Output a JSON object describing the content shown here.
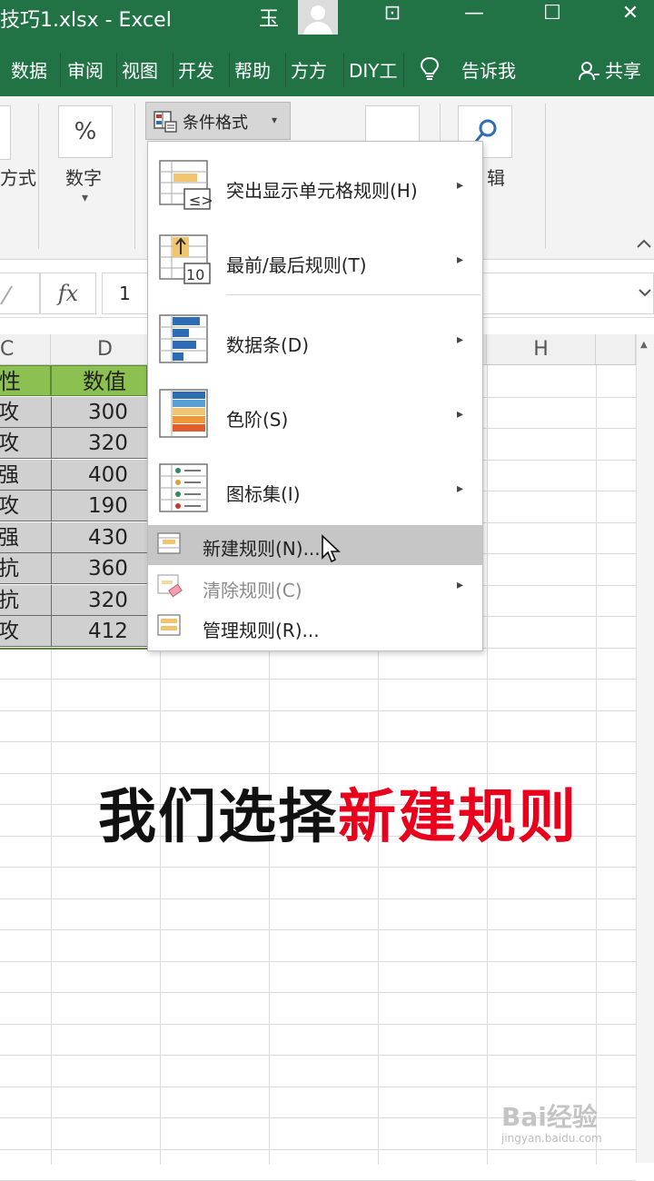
{
  "window": {
    "title": "技巧1.xlsx  -  Excel",
    "user_name": "玉",
    "minimize_glyph": "—",
    "restore_glyph": "☐",
    "close_glyph": "✕",
    "ribbon_display_glyph": "⊡"
  },
  "tabs": [
    {
      "label": "数据"
    },
    {
      "label": "审阅"
    },
    {
      "label": "视图"
    },
    {
      "label": "开发"
    },
    {
      "label": "帮助"
    },
    {
      "label": "方方"
    },
    {
      "label": "DIY工"
    }
  ],
  "tell_me": "告诉我",
  "share": "共享",
  "ribbon": {
    "align_label_partial": "方式",
    "number_icon": "%",
    "number_label": "数字",
    "conditional_format_label": "条件格式",
    "editing_label_partial": "辑",
    "dropdown_glyph": "▾"
  },
  "formula_bar": {
    "fx": "fx",
    "cell_value": "1"
  },
  "columns": [
    {
      "label": "C"
    },
    {
      "label": "D"
    },
    {
      "label": "H"
    }
  ],
  "table": {
    "header": [
      "性",
      "数值"
    ],
    "rows": [
      [
        "攻",
        "300"
      ],
      [
        "攻",
        "320"
      ],
      [
        "强",
        "400"
      ],
      [
        "攻",
        "190"
      ],
      [
        "强",
        "430"
      ],
      [
        "抗",
        "360"
      ],
      [
        "抗",
        "320"
      ],
      [
        "攻",
        "412"
      ]
    ]
  },
  "menu": {
    "items": [
      {
        "label": "突出显示单元格规则(H)",
        "icon": "highlight-cells-rules-icon",
        "has_submenu": true
      },
      {
        "label": "最前/最后规则(T)",
        "icon": "top-bottom-rules-icon",
        "has_submenu": true
      },
      {
        "label": "数据条(D)",
        "icon": "data-bars-icon",
        "has_submenu": true
      },
      {
        "label": "色阶(S)",
        "icon": "color-scales-icon",
        "has_submenu": true
      },
      {
        "label": "图标集(I)",
        "icon": "icon-sets-icon",
        "has_submenu": true
      },
      {
        "label": "新建规则(N)...",
        "icon": "new-rule-icon",
        "has_submenu": false,
        "hovered": true
      },
      {
        "label": "清除规则(C)",
        "icon": "clear-rules-icon",
        "has_submenu": true,
        "dimmed": true
      },
      {
        "label": "管理规则(R)...",
        "icon": "manage-rules-icon",
        "has_submenu": false
      }
    ],
    "submenu_arrow": "▸",
    "top_bottom_number": "10"
  },
  "caption": {
    "black_part": "我们选择",
    "red_part": "新建规则"
  },
  "watermark": {
    "brand": "Bai经验",
    "url": "jingyan.baidu.com"
  },
  "colors": {
    "excel_green": "#217346",
    "header_green": "#8cc152",
    "caption_red": "#e8001c"
  }
}
